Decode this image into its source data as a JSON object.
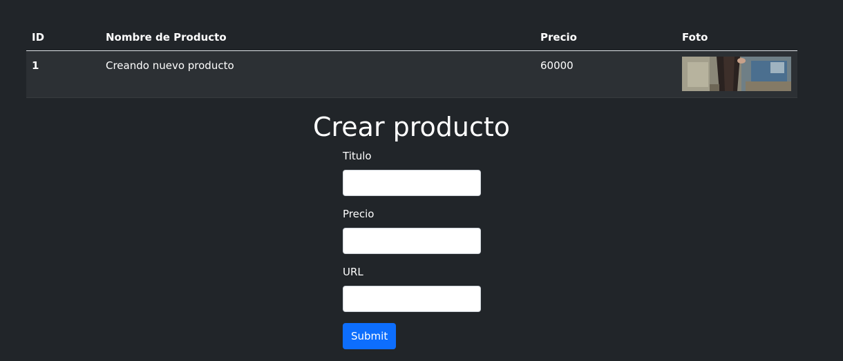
{
  "table": {
    "headers": [
      "ID",
      "Nombre de Producto",
      "Precio",
      "Foto"
    ],
    "rows": [
      {
        "id": "1",
        "name": "Creando nuevo producto",
        "price": "60000",
        "photo": "product-photo"
      }
    ]
  },
  "form": {
    "title": "Crear producto",
    "fields": [
      {
        "label": "Titulo",
        "value": "",
        "placeholder": ""
      },
      {
        "label": "Precio",
        "value": "",
        "placeholder": ""
      },
      {
        "label": "URL",
        "value": "",
        "placeholder": ""
      }
    ],
    "submit_label": "Submit"
  },
  "colors": {
    "background": "#212529",
    "row_background": "#2c3034",
    "primary_button": "#0d6efd"
  }
}
